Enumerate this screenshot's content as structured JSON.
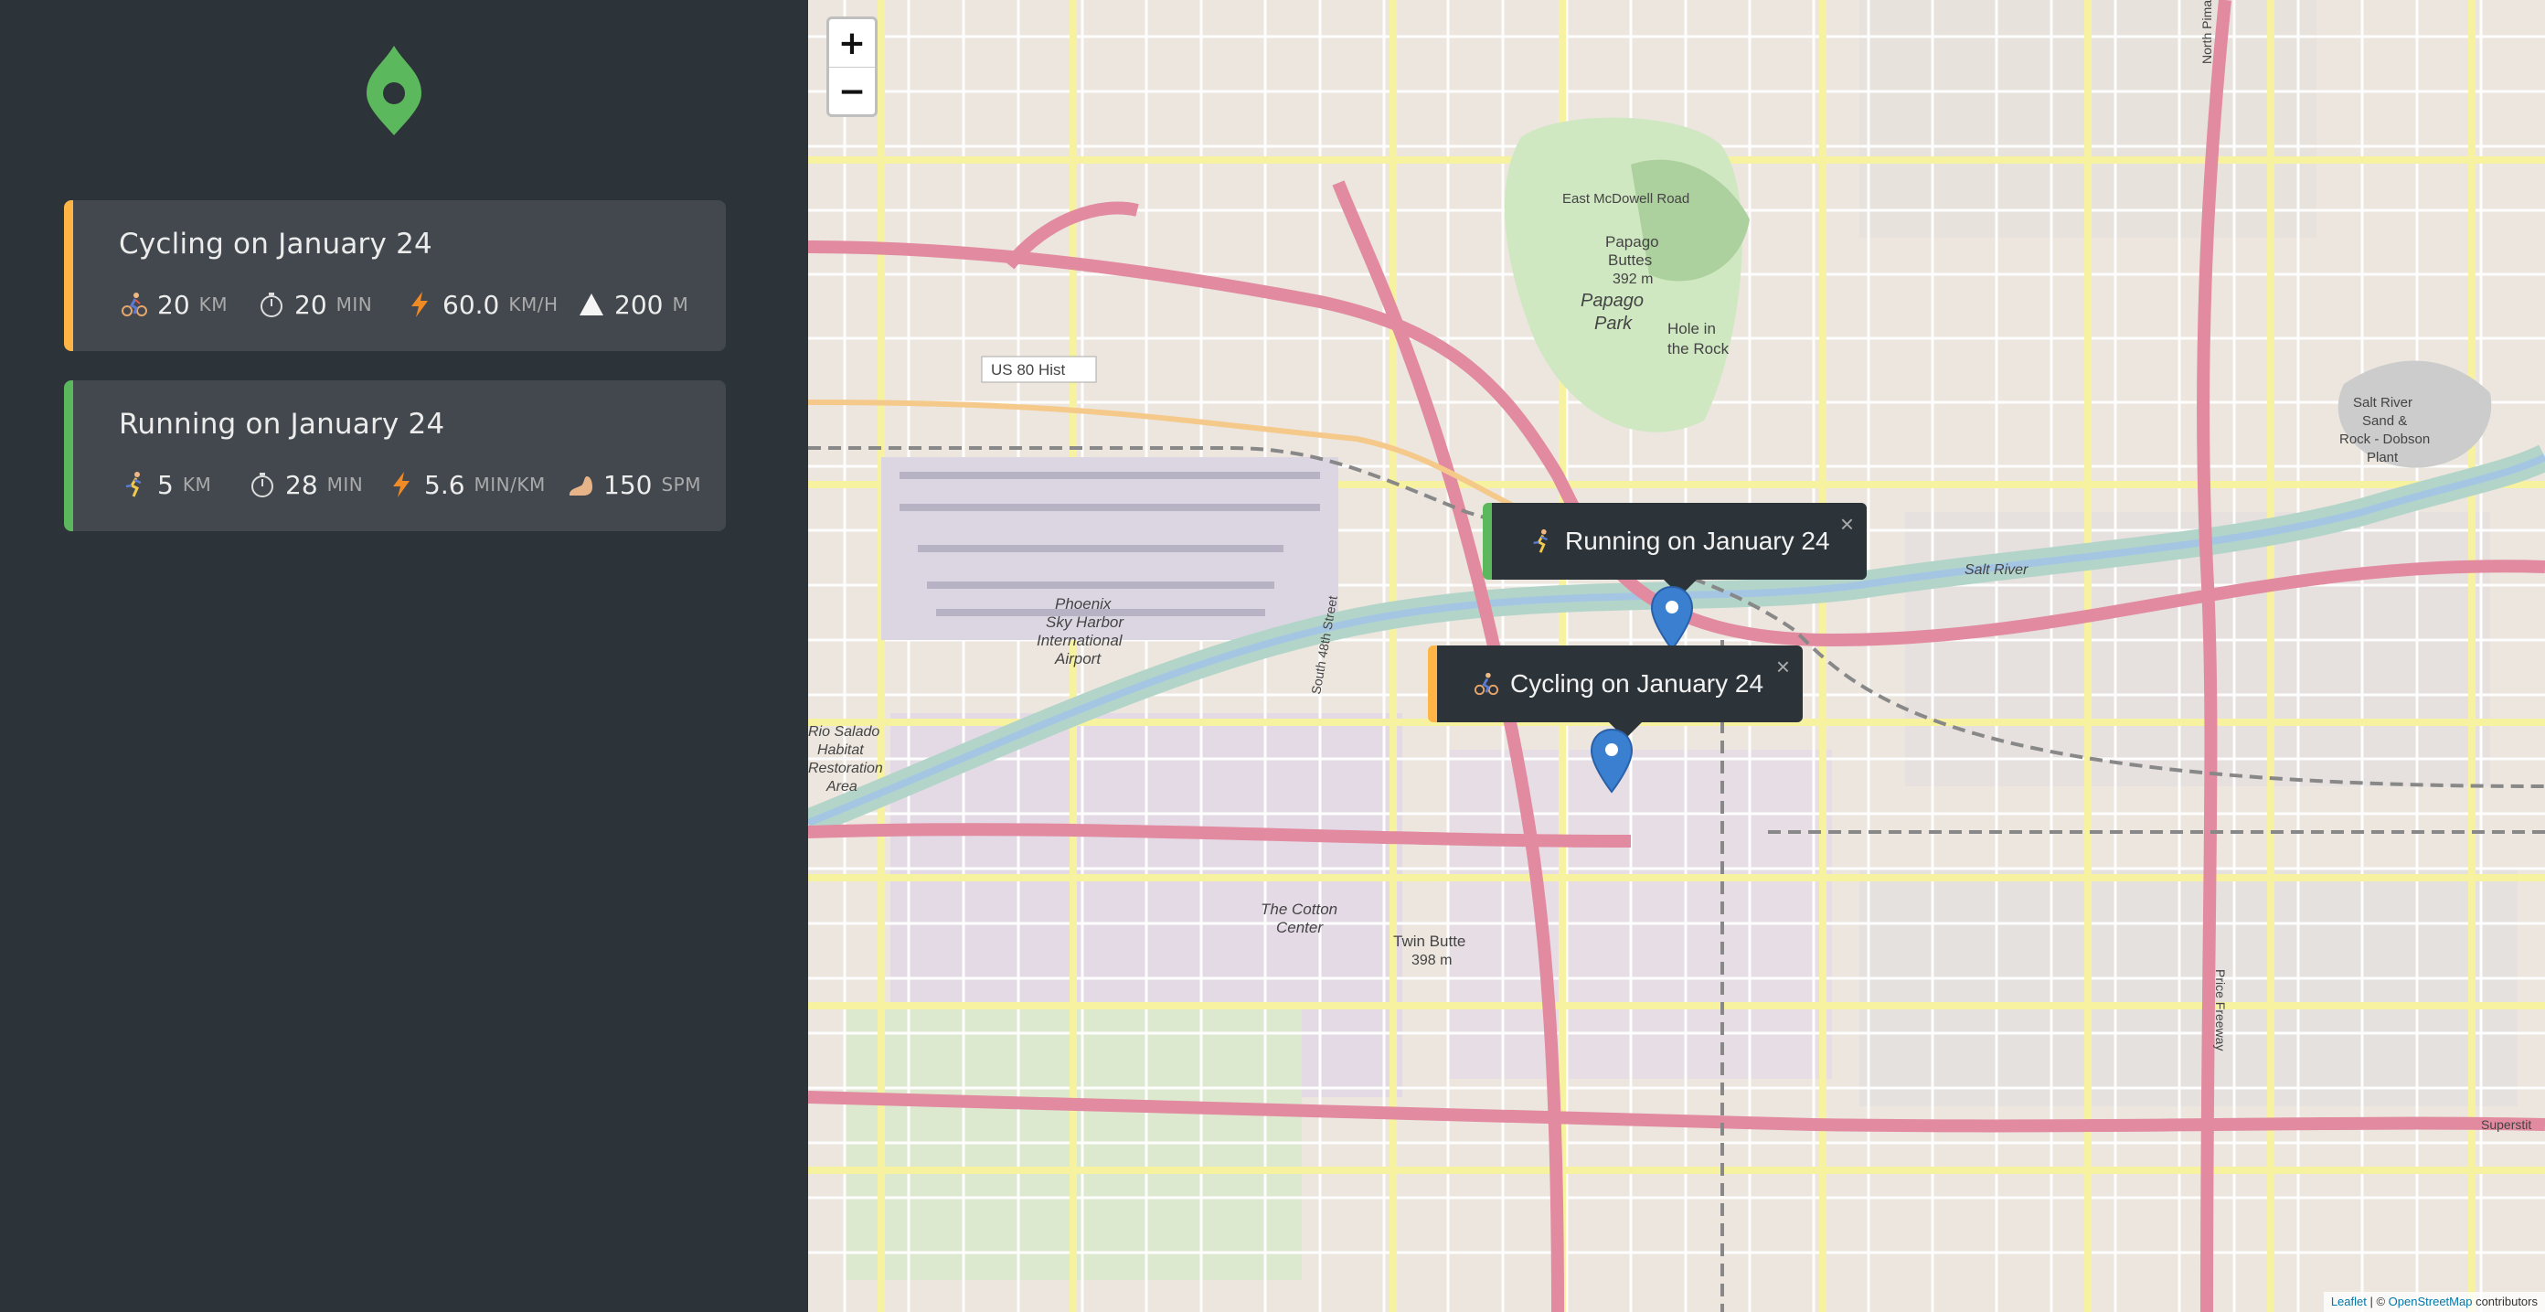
{
  "sidebar": {
    "workouts": [
      {
        "type": "cycling",
        "title": "Cycling on January 24",
        "accent": "#ffb545",
        "stats": [
          {
            "icon": "cyclist-icon",
            "value": "20",
            "unit": "km"
          },
          {
            "icon": "stopwatch-icon",
            "value": "20",
            "unit": "min"
          },
          {
            "icon": "lightning-icon",
            "value": "60.0",
            "unit": "km/h"
          },
          {
            "icon": "mountain-icon",
            "value": "200",
            "unit": "m"
          }
        ]
      },
      {
        "type": "running",
        "title": "Running on January 24",
        "accent": "#5cb85c",
        "stats": [
          {
            "icon": "runner-icon",
            "value": "5",
            "unit": "km"
          },
          {
            "icon": "stopwatch-icon",
            "value": "28",
            "unit": "min"
          },
          {
            "icon": "lightning-icon",
            "value": "5.6",
            "unit": "min/km"
          },
          {
            "icon": "footprint-icon",
            "value": "150",
            "unit": "spm"
          }
        ]
      }
    ]
  },
  "map": {
    "zoom_in": "+",
    "zoom_out": "−",
    "popups": [
      {
        "text": "Running on January 24",
        "close": "×"
      },
      {
        "text": "Cycling on January 24",
        "close": "×"
      }
    ],
    "labels": {
      "road_mcdowell": "East McDowell Road",
      "us80": "US 80 Hist",
      "papago_buttes": "Papago",
      "papago_buttes2": "Buttes",
      "papago_elev": "392 m",
      "papago_park": "Papago",
      "papago_park2": "Park",
      "hole_rock": "Hole in",
      "hole_rock2": "the Rock",
      "airport1": "Phoenix",
      "airport2": "Sky Harbor",
      "airport3": "International",
      "airport4": "Airport",
      "salt_river": "Salt River",
      "salt_river_sand1": "Salt River",
      "salt_river_sand2": "Sand &",
      "salt_river_sand3": "Rock - Dobson",
      "salt_river_sand4": "Plant",
      "rio_salado1": "Rio Salado",
      "rio_salado2": "Habitat",
      "rio_salado3": "Restoration",
      "rio_salado4": "Area",
      "cotton1": "The Cotton",
      "cotton2": "Center",
      "twin1": "Twin Butte",
      "twin2": "398 m",
      "price_fwy": "Price Freeway",
      "north_pima": "North Pima Road",
      "s_48th": "South 48th Street",
      "superstition": "Superstit"
    },
    "attribution": {
      "leaflet": "Leaflet",
      "sep": " | © ",
      "osm": "OpenStreetMap",
      "contrib": " contributors"
    }
  }
}
